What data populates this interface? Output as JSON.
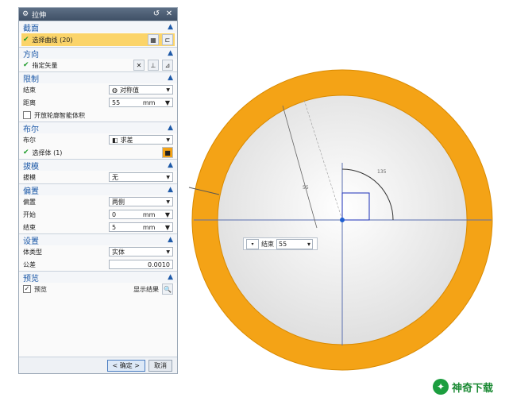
{
  "dialog": {
    "title": "拉伸",
    "sections": {
      "section": {
        "title": "截面",
        "select_curve": "选择曲线 (20)"
      },
      "direction": {
        "title": "方向",
        "vector_label": "指定矢量"
      },
      "limits": {
        "title": "限制",
        "end_label": "结束",
        "end_value": "对称值",
        "distance_label": "距离",
        "distance_value": "55",
        "distance_unit": "mm",
        "open_profile_label": "开放轮廓智能体积"
      },
      "boolean": {
        "title": "布尔",
        "boolean_label": "布尔",
        "boolean_value": "求差",
        "select_body": "选择体 (1)"
      },
      "draft": {
        "title": "拔模",
        "draft_label": "拔模",
        "draft_value": "无"
      },
      "offset": {
        "title": "偏置",
        "offset_label": "偏置",
        "offset_value": "两侧",
        "start_label": "开始",
        "start_value": "0",
        "start_unit": "mm",
        "end_label": "结束",
        "end_value": "5",
        "end_unit": "mm"
      },
      "settings": {
        "title": "设置",
        "body_type_label": "体类型",
        "body_type_value": "实体",
        "tolerance_label": "公差",
        "tolerance_value": "0.0010"
      },
      "preview": {
        "title": "预览",
        "preview_label": "预览",
        "show_result_label": "显示结果"
      }
    },
    "ok_label": "< 确定 >",
    "cancel_label": "取消"
  },
  "floating_input": {
    "label": "结束",
    "value": "55"
  },
  "dimension_labels": {
    "distance": "55",
    "angle": "135"
  },
  "watermark": {
    "text": "神奇下载"
  },
  "colors": {
    "ring": "#f4a316",
    "accent": "#1e5aa8",
    "highlight": "#fbd46a"
  }
}
